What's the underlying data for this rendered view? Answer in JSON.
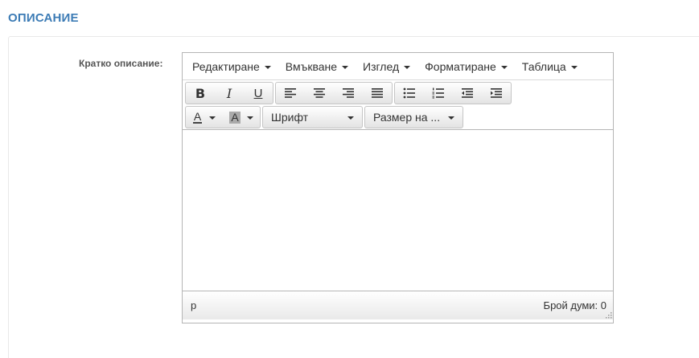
{
  "section": {
    "title": "ОПИСАНИЕ"
  },
  "field": {
    "label": "Кратко описание:"
  },
  "menubar": [
    {
      "label": "Редактиране"
    },
    {
      "label": "Вмъкване"
    },
    {
      "label": "Изглед"
    },
    {
      "label": "Форматиране"
    },
    {
      "label": "Таблица"
    }
  ],
  "toolbar": {
    "bold": "B",
    "italic": "I",
    "underline": "U",
    "text_color": "A",
    "background_color": "A",
    "font_family": "Шрифт",
    "font_size": "Размер на ..."
  },
  "statusbar": {
    "path": "p",
    "word_count": "Брой думи: 0"
  },
  "colors": {
    "section_title": "#3c7bb5",
    "border": "#b5b5b5"
  }
}
